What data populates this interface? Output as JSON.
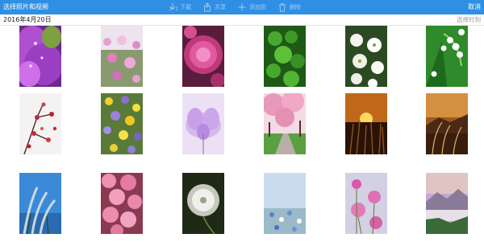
{
  "header": {
    "title": "选择照片和视频",
    "cancel_label": "取消",
    "actions": [
      {
        "label": "下载",
        "icon": "download-icon"
      },
      {
        "label": "共享",
        "icon": "share-icon"
      },
      {
        "label": "添加到",
        "icon": "plus-icon"
      },
      {
        "label": "删除",
        "icon": "trash-icon"
      }
    ],
    "accent_color": "#2f8fe4"
  },
  "section": {
    "date": "2016年4月20日",
    "select_label": "选择时刻"
  },
  "photos": [
    {
      "subject": "purple tulip with dew drops"
    },
    {
      "subject": "pink cosmos field"
    },
    {
      "subject": "pink dahlia"
    },
    {
      "subject": "green clover leaves"
    },
    {
      "subject": "white dogwood blossoms"
    },
    {
      "subject": "lily of the valley"
    },
    {
      "subject": "red plum blossom branch"
    },
    {
      "subject": "yellow and purple wildflowers"
    },
    {
      "subject": "pale purple bloom"
    },
    {
      "subject": "cherry blossom path"
    },
    {
      "subject": "pampas grass at sunset"
    },
    {
      "subject": "silver grass at dusk"
    },
    {
      "subject": "pampas grass against blue sky"
    },
    {
      "subject": "pink cherry blossoms"
    },
    {
      "subject": "dandelion seed head"
    },
    {
      "subject": "small blue flowers"
    },
    {
      "subject": "pink cosmos flowers"
    },
    {
      "subject": "misty mountain landscape"
    }
  ]
}
